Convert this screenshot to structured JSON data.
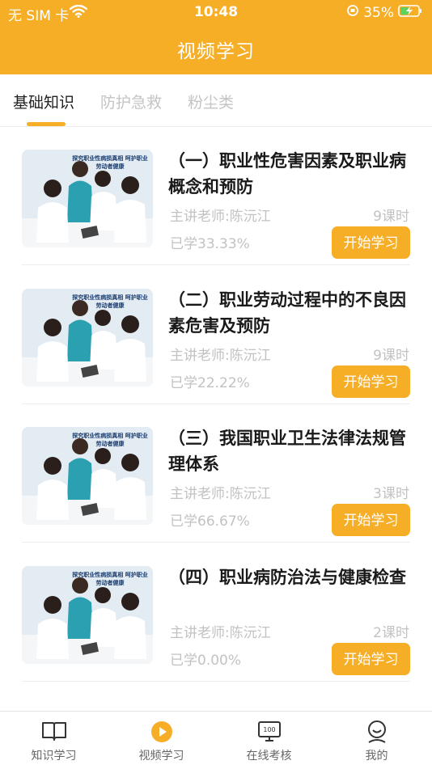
{
  "status_bar": {
    "carrier": "无 SIM 卡",
    "time": "10:48",
    "battery": "35%"
  },
  "header": {
    "title": "视频学习"
  },
  "tabs": [
    {
      "label": "基础知识",
      "active": true
    },
    {
      "label": "防护急救",
      "active": false
    },
    {
      "label": "粉尘类",
      "active": false
    }
  ],
  "courses": [
    {
      "title": "（一）职业性危害因素及职业病概念和预防",
      "teacher": "主讲老师:陈沅江",
      "hours": "9课时",
      "progress": "已学33.33%",
      "button": "开始学习",
      "thumb_caption": "探究职业性病损真相 呵护职业劳动者健康"
    },
    {
      "title": "（二）职业劳动过程中的不良因素危害及预防",
      "teacher": "主讲老师:陈沅江",
      "hours": "9课时",
      "progress": "已学22.22%",
      "button": "开始学习",
      "thumb_caption": "探究职业性病损真相 呵护职业劳动者健康"
    },
    {
      "title": "（三）我国职业卫生法律法规管理体系",
      "teacher": "主讲老师:陈沅江",
      "hours": "3课时",
      "progress": "已学66.67%",
      "button": "开始学习",
      "thumb_caption": "探究职业性病损真相 呵护职业劳动者健康"
    },
    {
      "title": "（四）职业病防治法与健康检查",
      "teacher": "主讲老师:陈沅江",
      "hours": "2课时",
      "progress": "已学0.00%",
      "button": "开始学习",
      "thumb_caption": "探究职业性病损真相 呵护职业劳动者健康"
    }
  ],
  "tabbar": [
    {
      "label": "知识学习",
      "icon": "book-icon"
    },
    {
      "label": "视频学习",
      "icon": "play-icon",
      "active": true
    },
    {
      "label": "在线考核",
      "icon": "exam-monitor-icon"
    },
    {
      "label": "我的",
      "icon": "profile-icon"
    }
  ],
  "colors": {
    "accent": "#F7AE27",
    "muted_text": "#C2C2C2",
    "title_text": "#1A1A1A"
  }
}
